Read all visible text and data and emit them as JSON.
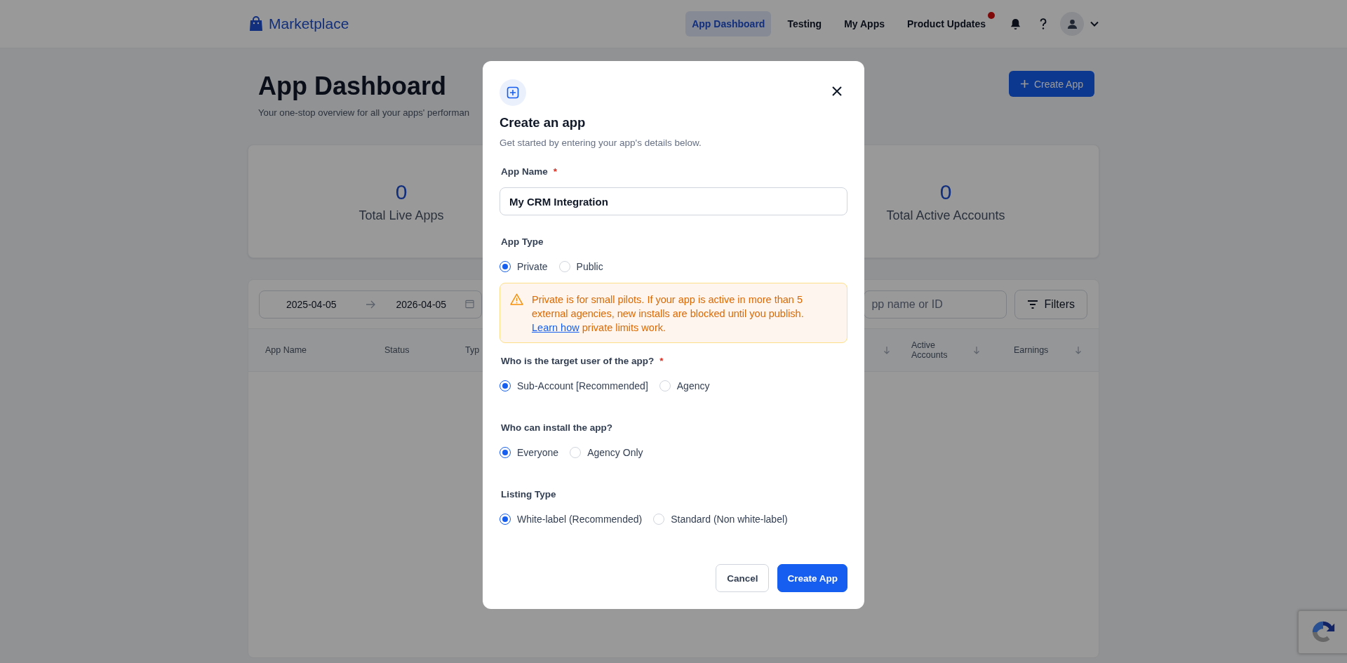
{
  "header": {
    "logo": "Marketplace",
    "nav": [
      {
        "label": "App Dashboard",
        "selected": true,
        "unread": false
      },
      {
        "label": "Testing",
        "selected": false,
        "unread": false
      },
      {
        "label": "My Apps",
        "selected": false,
        "unread": false
      },
      {
        "label": "Product Updates",
        "selected": false,
        "unread": true
      }
    ]
  },
  "page": {
    "title": "App Dashboard",
    "subtitle": "Your one-stop overview for all your apps' performan",
    "create_button": "Create App"
  },
  "stats": [
    {
      "value": "0",
      "label": "Total Live Apps"
    },
    {
      "value": "0",
      "label": "Total Active Accounts"
    }
  ],
  "table": {
    "date_range": {
      "start": "2025-04-05",
      "end": "2026-04-05"
    },
    "search": {
      "placeholder": "pp name or ID"
    },
    "filters_button": "Filters",
    "columns": [
      {
        "label": "App Name",
        "sortable": false
      },
      {
        "label": "Status",
        "sortable": false
      },
      {
        "label": "Typ",
        "sortable": false
      },
      {
        "sortable": true
      },
      {
        "label": "Active Accounts",
        "sortable": true
      },
      {
        "label": "Earnings",
        "sortable": true
      }
    ]
  },
  "modal": {
    "title": "Create an app",
    "subtitle": "Get started by entering your app's details below.",
    "app_name": {
      "label": "App Name",
      "required_mark": "*",
      "value": "My CRM Integration"
    },
    "sections": [
      {
        "kind": "radio",
        "label": "App Type",
        "options": [
          {
            "label": "Private",
            "selected": true
          },
          {
            "label": "Public",
            "selected": false
          }
        ]
      },
      {
        "kind": "alert",
        "text": "Private is for small pilots. If your app is active in more than 5 external agencies, new installs are blocked until you publish.",
        "link": "Learn how",
        "after": "private limits work."
      },
      {
        "kind": "radio",
        "label": "Who is the target user of the app?",
        "required_mark": "*",
        "options": [
          {
            "label": "Sub-Account [Recommended]",
            "selected": true
          },
          {
            "label": "Agency",
            "selected": false
          }
        ]
      },
      {
        "kind": "radio",
        "label": "Who can install the app?",
        "options": [
          {
            "label": "Everyone",
            "selected": true
          },
          {
            "label": "Agency Only",
            "selected": false
          }
        ]
      },
      {
        "kind": "radio",
        "label": "Listing Type",
        "options": [
          {
            "label": "White-label (Recommended)",
            "selected": true
          },
          {
            "label": "Standard (Non white-label)",
            "selected": false
          }
        ]
      }
    ],
    "buttons": [
      {
        "label": "Cancel",
        "kind": "secondary"
      },
      {
        "label": "Create App",
        "kind": "primary"
      }
    ]
  }
}
